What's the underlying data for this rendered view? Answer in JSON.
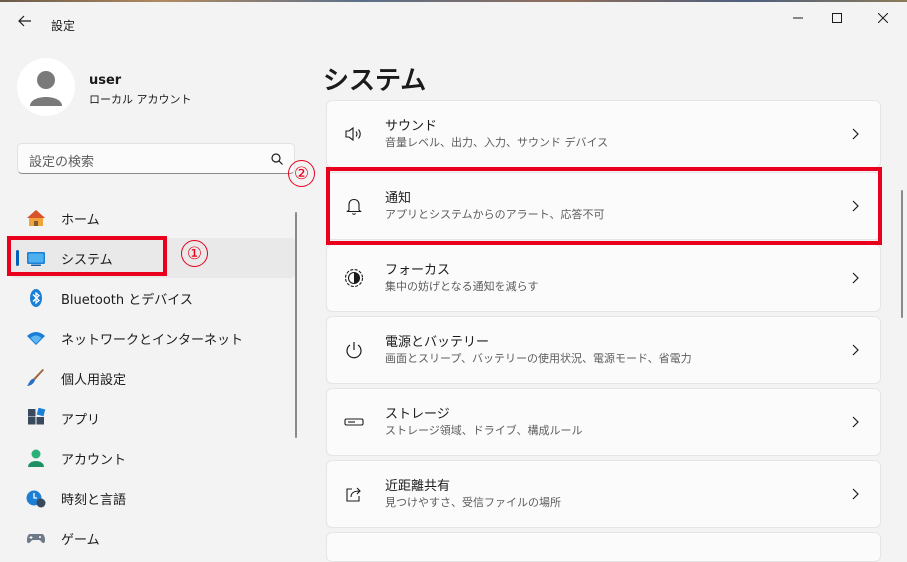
{
  "window": {
    "title": "設定"
  },
  "profile": {
    "name": "user",
    "account_type": "ローカル アカウント"
  },
  "search": {
    "placeholder": "設定の検索"
  },
  "nav": {
    "items": [
      {
        "label": "ホーム",
        "icon": "home-icon"
      },
      {
        "label": "システム",
        "icon": "system-display-icon",
        "selected": true
      },
      {
        "label": "Bluetooth とデバイス",
        "icon": "bluetooth-icon"
      },
      {
        "label": "ネットワークとインターネット",
        "icon": "wifi-icon"
      },
      {
        "label": "個人用設定",
        "icon": "paintbrush-icon"
      },
      {
        "label": "アプリ",
        "icon": "apps-icon"
      },
      {
        "label": "アカウント",
        "icon": "account-icon"
      },
      {
        "label": "時刻と言語",
        "icon": "time-language-icon"
      },
      {
        "label": "ゲーム",
        "icon": "gamepad-icon"
      }
    ]
  },
  "page": {
    "title": "システム"
  },
  "cards": [
    {
      "title": "サウンド",
      "subtitle": "音量レベル、出力、入力、サウンド デバイス",
      "icon": "speaker-icon"
    },
    {
      "title": "通知",
      "subtitle": "アプリとシステムからのアラート、応答不可",
      "icon": "bell-icon"
    },
    {
      "title": "フォーカス",
      "subtitle": "集中の妨げとなる通知を減らす",
      "icon": "focus-icon"
    },
    {
      "title": "電源とバッテリー",
      "subtitle": "画面とスリープ、バッテリーの使用状況、電源モード、省電力",
      "icon": "power-icon"
    },
    {
      "title": "ストレージ",
      "subtitle": "ストレージ領域、ドライブ、構成ルール",
      "icon": "storage-icon"
    },
    {
      "title": "近距離共有",
      "subtitle": "見つけやすさ、受信ファイルの場所",
      "icon": "share-icon"
    }
  ],
  "annotations": {
    "step1": "①",
    "step2": "②",
    "color": "#e8001c"
  },
  "colors": {
    "accent": "#005fb8",
    "annotation": "#e8001c"
  }
}
